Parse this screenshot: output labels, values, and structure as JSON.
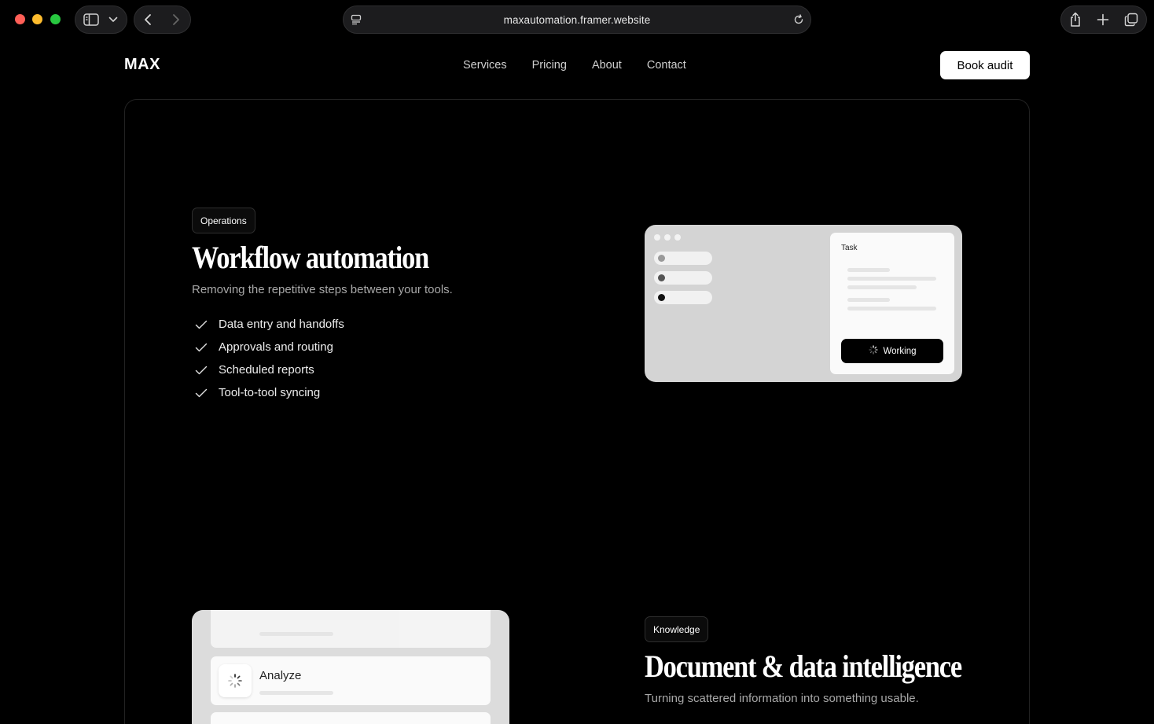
{
  "browser": {
    "url": "maxautomation.framer.website"
  },
  "site": {
    "logo": "MAX",
    "nav": [
      "Services",
      "Pricing",
      "About",
      "Contact"
    ],
    "cta": "Book audit"
  },
  "section_workflow": {
    "badge": "Operations",
    "title": "Workflow automation",
    "subtitle": "Removing the repetitive steps between your tools.",
    "features": [
      "Data entry and handoffs",
      "Approvals and routing",
      "Scheduled reports",
      "Tool-to-tool syncing"
    ],
    "mockup": {
      "task_label": "Task",
      "status": "Working"
    }
  },
  "section_documents": {
    "badge": "Knowledge",
    "title": "Document & data intelligence",
    "subtitle": "Turning scattered information into something usable.",
    "mockup": {
      "step": "Analyze"
    }
  }
}
